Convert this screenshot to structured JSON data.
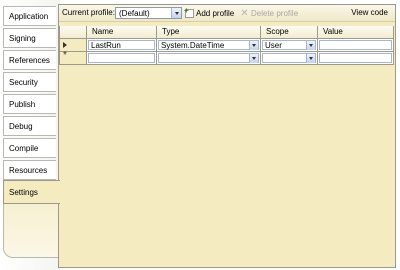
{
  "tabs": [
    {
      "label": "Application"
    },
    {
      "label": "Signing"
    },
    {
      "label": "References"
    },
    {
      "label": "Security"
    },
    {
      "label": "Publish"
    },
    {
      "label": "Debug"
    },
    {
      "label": "Compile"
    },
    {
      "label": "Resources"
    },
    {
      "label": "Settings",
      "selected": true
    }
  ],
  "toolbar": {
    "profile_label": "Current profile:",
    "profile_value": "(Default)",
    "add_profile": "Add profile",
    "delete_profile": "Delete profile",
    "view_code": "View code"
  },
  "grid": {
    "headers": {
      "name": "Name",
      "type": "Type",
      "scope": "Scope",
      "value": "Value"
    },
    "rows": [
      {
        "name": "LastRun",
        "type": "System.DateTime",
        "scope": "User",
        "value": ""
      }
    ],
    "new_row": {
      "name": "",
      "type": "",
      "scope": "",
      "value": ""
    }
  },
  "colors": {
    "panel_background": "#f4ebc0",
    "border": "#9c9a8a",
    "combo_border": "#a8b6c8"
  }
}
